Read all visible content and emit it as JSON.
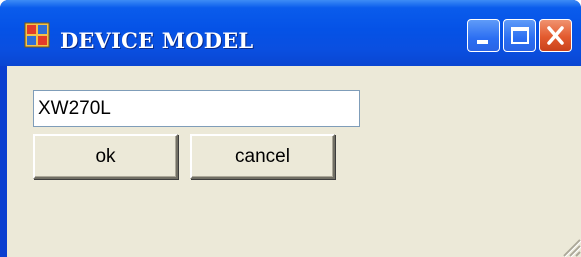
{
  "window": {
    "title": "DEVICE MODEL",
    "controls": {
      "minimize_icon": "minimize-icon",
      "maximize_icon": "maximize-icon",
      "close_icon": "close-icon"
    }
  },
  "form": {
    "model_value": "XW270L",
    "ok_label": "ok",
    "cancel_label": "cancel"
  },
  "colors": {
    "titlebar": "#0552e6",
    "client_bg": "#ece9d8",
    "close_button": "#e35a2e",
    "field_border": "#7f9db9"
  }
}
